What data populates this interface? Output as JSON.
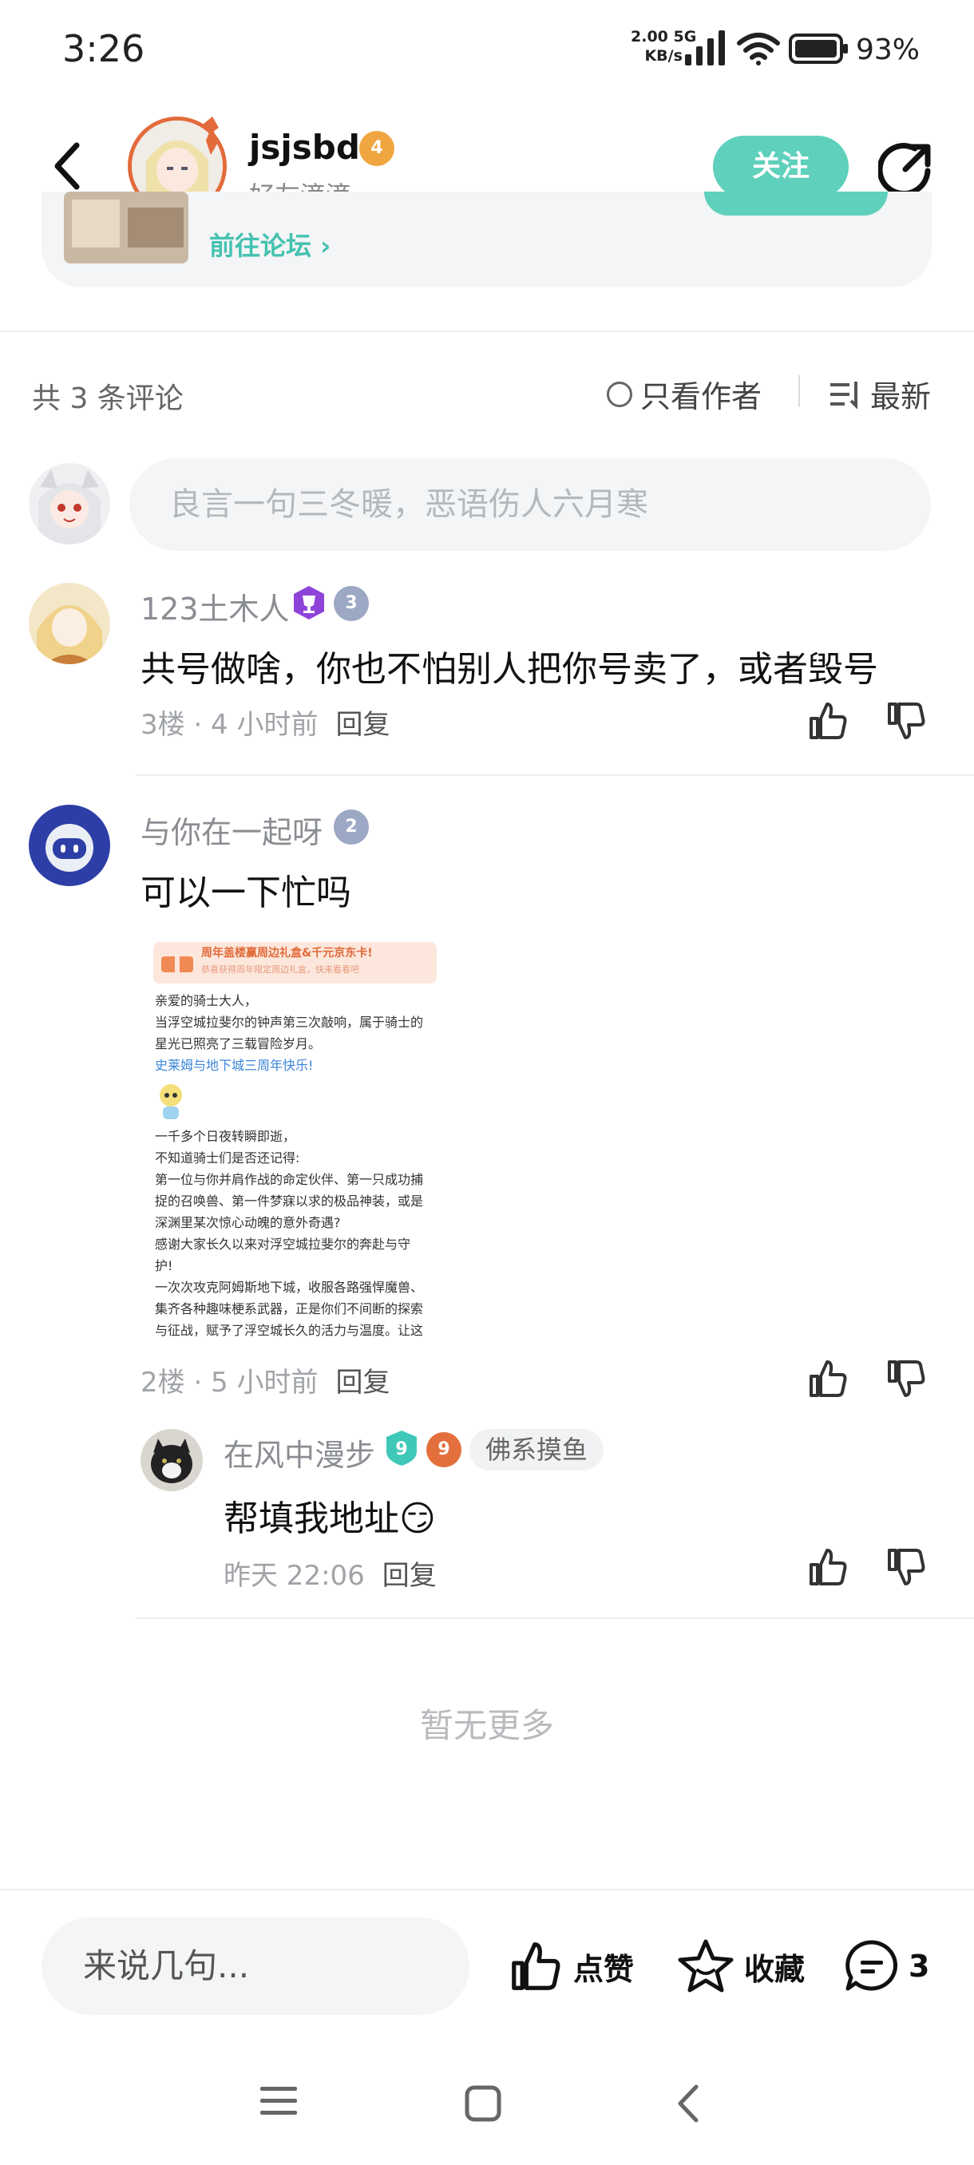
{
  "status_bar": {
    "time": "3:26",
    "net_speed_value": "2.00",
    "net_speed_unit": "KB/s",
    "network": "5G",
    "battery": "93%"
  },
  "header": {
    "username": "jsjsbd",
    "subtitle": "好友滴滴",
    "level_badge": "4",
    "follow_label": "关注",
    "back_icon": "chevron-left-icon",
    "share_icon": "share-icon"
  },
  "forum_card": {
    "link_label": "前往论坛",
    "chevron": "›"
  },
  "comments_header": {
    "count_label": "共 3 条评论",
    "author_only_label": "只看作者",
    "sort_label": "最新"
  },
  "comment_input": {
    "placeholder": "良言一句三冬暖，恶语伤人六月寒"
  },
  "comments": [
    {
      "username": "123土木人",
      "level_badge": "3",
      "text": "共号做啥，你也不怕别人把你号卖了，或者毁号",
      "meta": "3楼 · 4 小时前",
      "reply_label": "回复"
    },
    {
      "username": "与你在一起呀",
      "level_badge": "2",
      "text": "可以一下忙吗",
      "meta": "2楼 · 5 小时前",
      "reply_label": "回复",
      "image": {
        "banner_title": "周年盖楼赢周边礼盒&千元京东卡!",
        "banner_sub": "恭喜获得周年限定周边礼盒，快来看看吧",
        "lines": [
          "亲爱的骑士大人，",
          "当浮空城拉斐尔的钟声第三次敲响，属于骑士的",
          "星光已照亮了三载冒险岁月。"
        ],
        "highlight": "史莱姆与地下城三周年快乐!",
        "lines2": [
          "一千多个日夜转瞬即逝，",
          "不知道骑士们是否还记得:",
          "第一位与你并肩作战的命定伙伴、第一只成功捕",
          "捉的召唤兽、第一件梦寐以求的极品神装，或是",
          "深渊里某次惊心动魄的意外奇遇?",
          "感谢大家长久以来对浮空城拉斐尔的奔赴与守",
          "护!",
          "一次次攻克阿姆斯地下城，收服各路强悍魔兽、",
          "集齐各种趣味梗系武器，正是你们不间断的探索",
          "与征战，赋予了浮空城长久的活力与温度。让这"
        ]
      },
      "replies": [
        {
          "username": "在风中漫步",
          "level_badge_a": "9",
          "level_badge_b": "9",
          "tag": "佛系摸鱼",
          "text": "帮填我地址",
          "emoji": "😏",
          "meta": "昨天 22:06",
          "reply_label": "回复"
        }
      ]
    }
  ],
  "no_more_label": "暂无更多",
  "bottom_bar": {
    "input_placeholder": "来说几句...",
    "like_label": "点赞",
    "favorite_label": "收藏",
    "comment_count": "3"
  },
  "colors": {
    "accent": "#5ed0bb",
    "link": "#45c2b1",
    "muted_text": "#8a8d92"
  }
}
